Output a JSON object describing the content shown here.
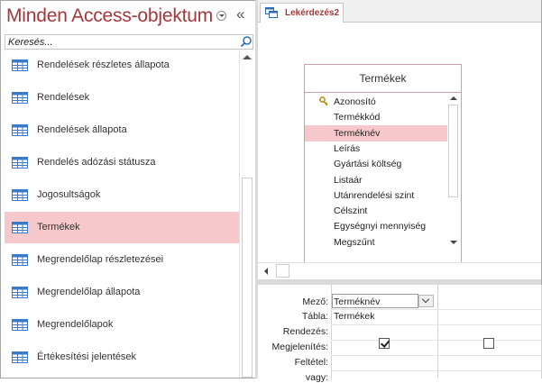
{
  "nav": {
    "title": "Minden Access-objektum",
    "collapse_glyph": "«",
    "search_placeholder": "Keresés...",
    "items": [
      {
        "label": "Rendelések részletes állapota",
        "icon": "table-icon"
      },
      {
        "label": "Rendelések",
        "icon": "table-icon"
      },
      {
        "label": "Rendelések állapota",
        "icon": "table-icon"
      },
      {
        "label": "Rendelés adózási státusza",
        "icon": "table-icon"
      },
      {
        "label": "Jogosultságok",
        "icon": "table-icon"
      },
      {
        "label": "Termékek",
        "icon": "table-icon",
        "selected": true
      },
      {
        "label": "Megrendelőlap részletezései",
        "icon": "table-icon"
      },
      {
        "label": "Megrendelőlap állapota",
        "icon": "table-icon"
      },
      {
        "label": "Megrendelőlapok",
        "icon": "table-icon"
      },
      {
        "label": "Értékesítési jelentések",
        "icon": "table-icon"
      }
    ]
  },
  "document": {
    "tab_label": "Lekérdezés2",
    "tab_icon": "query-icon"
  },
  "table_box": {
    "title": "Termékek",
    "fields": [
      {
        "label": "Azonosító",
        "primary_key": true
      },
      {
        "label": "Termékkód"
      },
      {
        "label": "Terméknév",
        "selected": true
      },
      {
        "label": "Leírás"
      },
      {
        "label": "Gyártási költség"
      },
      {
        "label": "Listaár"
      },
      {
        "label": "Utánrendelési szint"
      },
      {
        "label": "Célszint"
      },
      {
        "label": "Egységnyi mennyiség"
      },
      {
        "label": "Megszűnt"
      }
    ]
  },
  "qbe": {
    "row_labels": {
      "field": "Mező:",
      "table": "Tábla:",
      "sort": "Rendezés:",
      "show": "Megjelenítés:",
      "criteria": "Feltétel:",
      "or": "vagy:"
    },
    "columns": [
      {
        "field": "Terméknév",
        "table": "Termékek",
        "show": true
      },
      {
        "field": "",
        "table": "",
        "show": false
      }
    ]
  },
  "colors": {
    "accent": "#a4373a",
    "selection": "#f7c8cb"
  }
}
